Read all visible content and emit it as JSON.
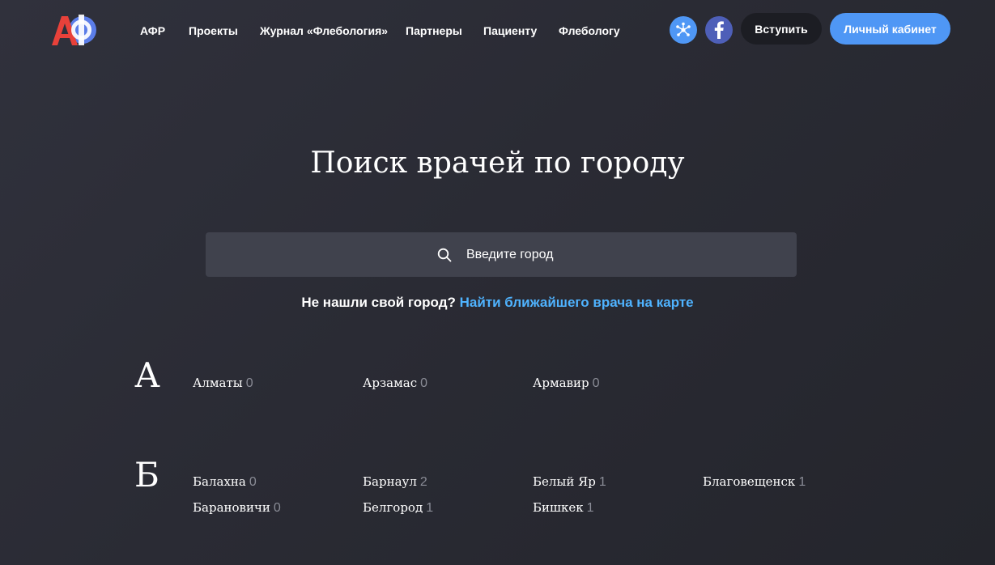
{
  "header": {
    "logo_text": "АФ",
    "nav": [
      "АФР",
      "Проекты",
      "Журнал «Флебология»",
      "Партнеры",
      "Пациенту",
      "Флебологу"
    ],
    "icons": [
      "network-icon",
      "facebook-icon"
    ],
    "join_label": "Вступить",
    "cabinet_label": "Личный кабинет",
    "colors": {
      "accent": "#4f97f5",
      "link": "#4fb3ff",
      "facebook": "#4e5fb8"
    }
  },
  "main": {
    "title": "Поиск врачей по городу",
    "search_placeholder": "Введите город",
    "not_found_text": "Не нашли свой город?",
    "not_found_link": "Найти ближайшего врача на карте"
  },
  "groups": [
    {
      "letter": "А",
      "cities": [
        {
          "name": "Алматы",
          "count": "0"
        },
        {
          "name": "Арзамас",
          "count": "0"
        },
        {
          "name": "Армавир",
          "count": "0"
        }
      ]
    },
    {
      "letter": "Б",
      "cities": [
        {
          "name": "Балахна",
          "count": "0"
        },
        {
          "name": "Барнаул",
          "count": "2"
        },
        {
          "name": "Белый Яр",
          "count": "1"
        },
        {
          "name": "Благовещенск",
          "count": "1"
        },
        {
          "name": "Барановичи",
          "count": "0"
        },
        {
          "name": "Белгород",
          "count": "1"
        },
        {
          "name": "Бишкек",
          "count": "1"
        }
      ]
    }
  ]
}
